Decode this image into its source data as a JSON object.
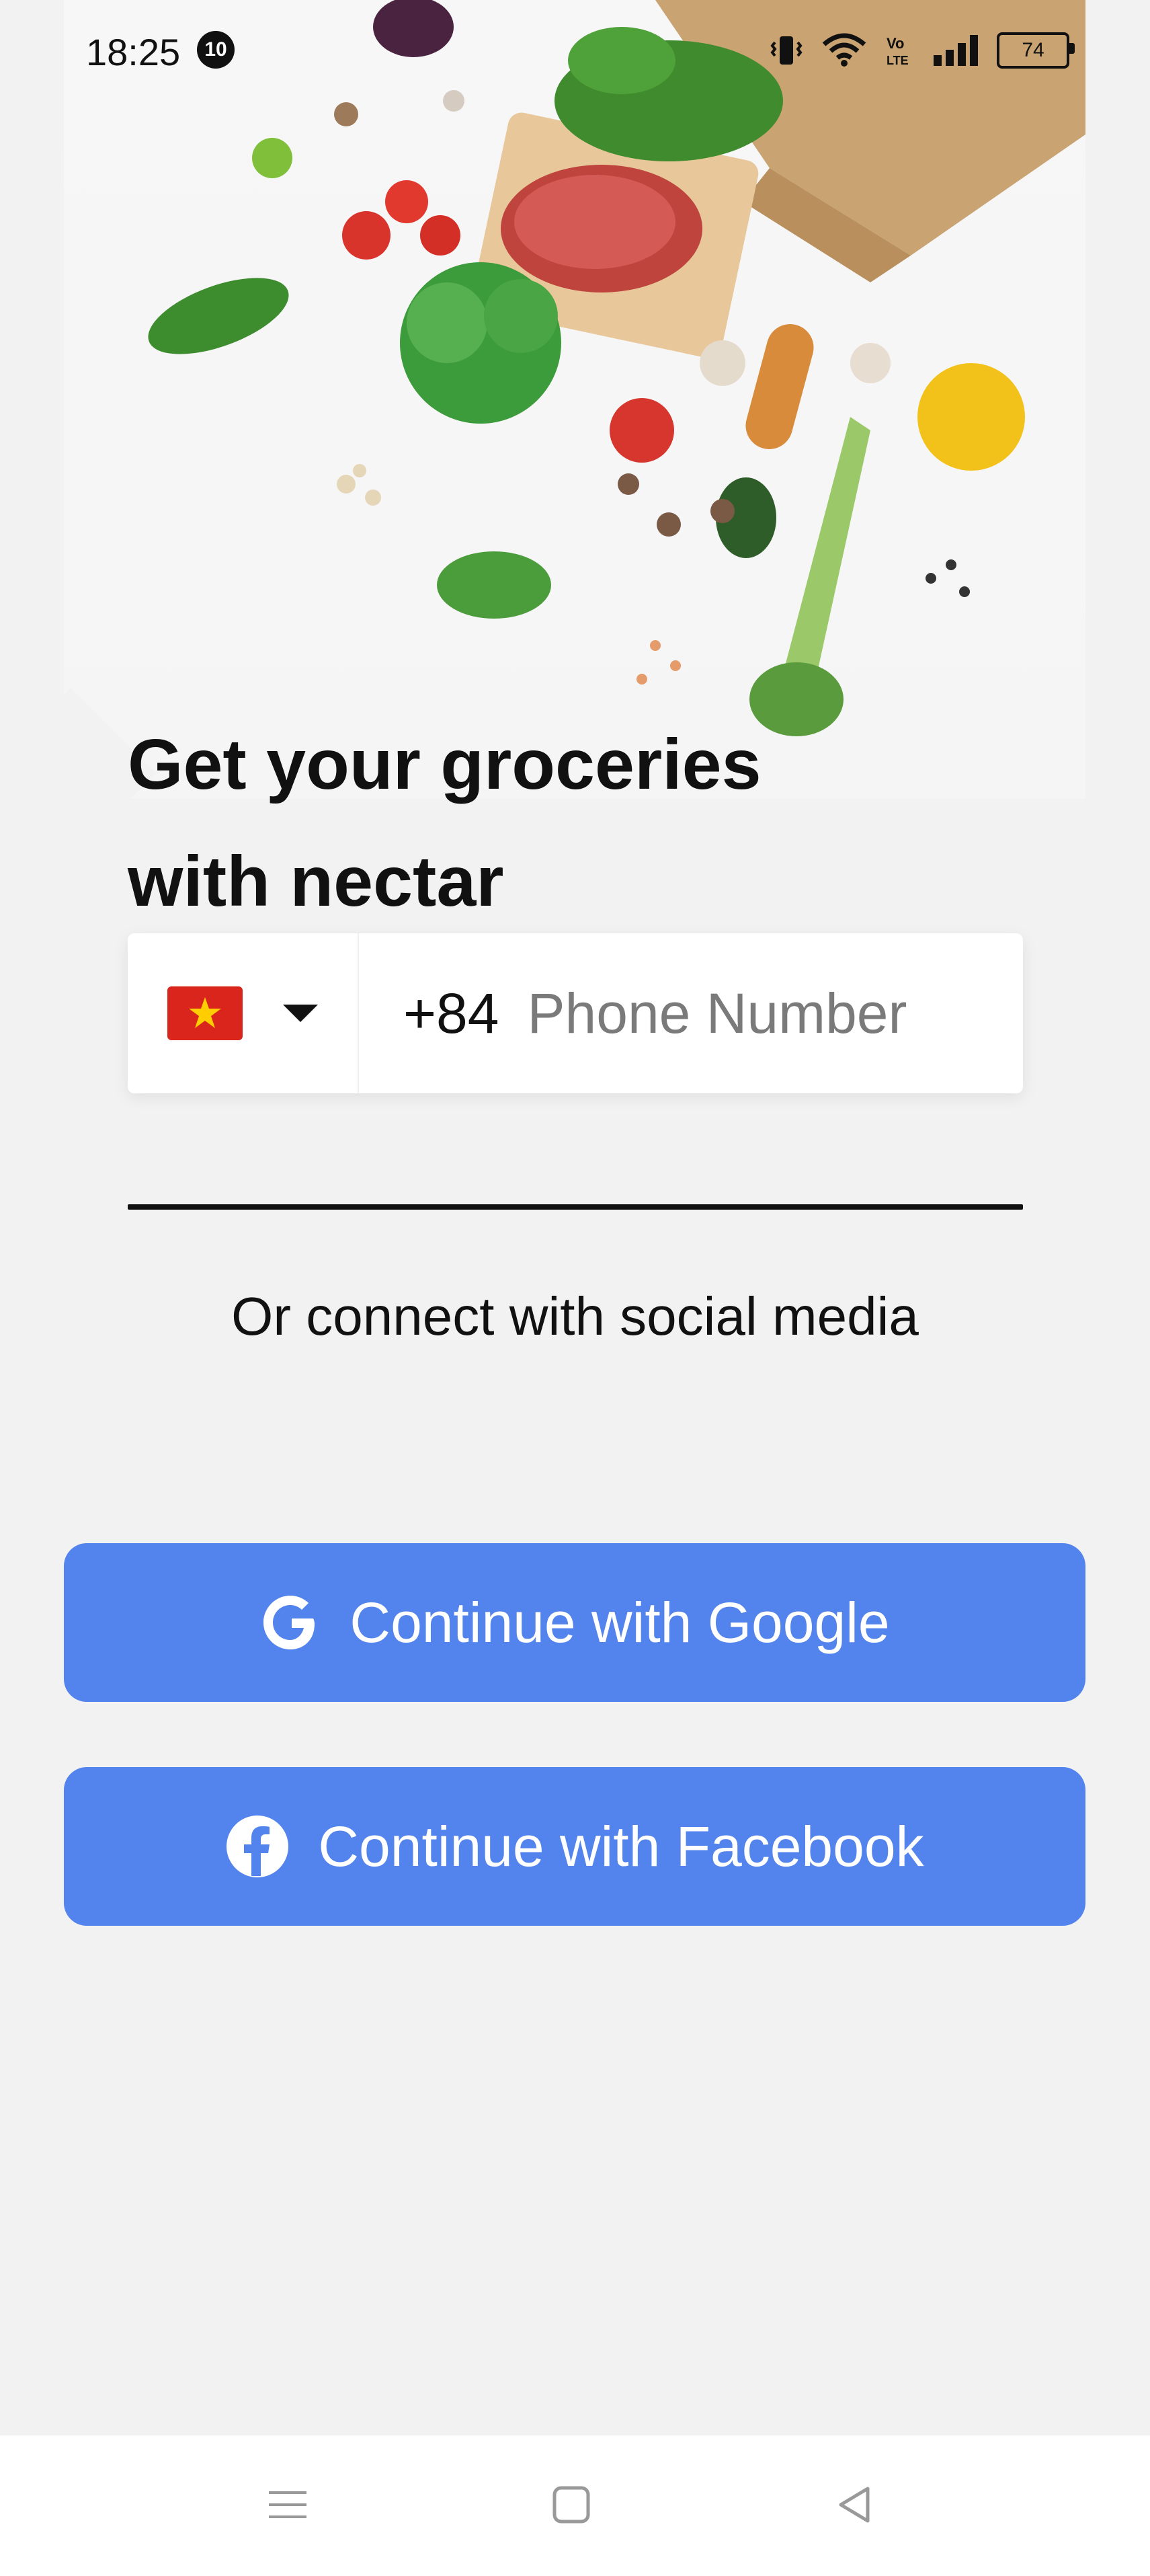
{
  "status_bar": {
    "time": "18:25",
    "notification_count": "10",
    "battery": "74",
    "icons": [
      "vibrate-icon",
      "wifi-icon",
      "volte-icon",
      "signal-icon",
      "battery-icon"
    ]
  },
  "hero": {
    "image": "groceries-illustration"
  },
  "headline": {
    "line1": "Get your groceries",
    "line2": "with nectar"
  },
  "phone": {
    "country_flag": "Vietnam",
    "dial_code": "+84",
    "placeholder": "Phone Number",
    "value": ""
  },
  "social": {
    "connect_label": "Or connect with social media",
    "google_label": "Continue with Google",
    "facebook_label": "Continue with Facebook",
    "button_color": "#5383ec"
  },
  "navigation": {
    "items": [
      "menu-icon",
      "home-icon",
      "back-icon"
    ]
  }
}
